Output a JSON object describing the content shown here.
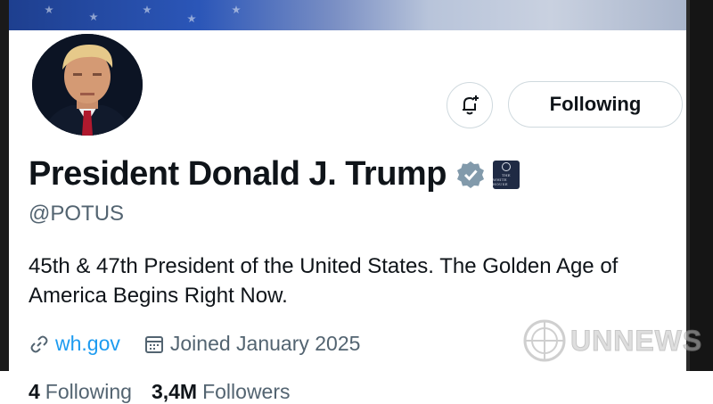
{
  "profile": {
    "display_name": "President Donald J. Trump",
    "handle": "@POTUS",
    "bio": "45th & 47th President of the United States. The Golden Age of America Begins Right Now.",
    "website": "wh.gov",
    "joined": "Joined January 2025",
    "following_count": "4",
    "following_label": "Following",
    "followers_count": "3,4M",
    "followers_label": "Followers",
    "badge_text_line1": "THE",
    "badge_text_line2": "WHITE HOUSE"
  },
  "actions": {
    "follow_state_label": "Following"
  },
  "watermark": {
    "text": "UNNEWS"
  },
  "icons": {
    "notify": "bell-plus-icon",
    "verified": "verified-badge-icon",
    "link": "link-icon",
    "calendar": "calendar-icon"
  },
  "colors": {
    "link": "#1d9bf0",
    "verified_badge": "#829aab",
    "secondary_text": "#536471",
    "primary_text": "#0f1419"
  }
}
